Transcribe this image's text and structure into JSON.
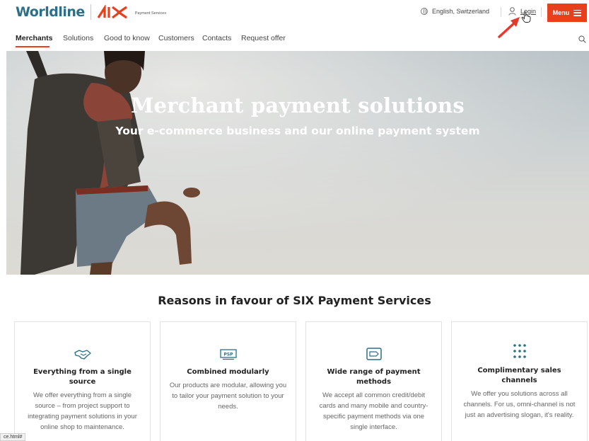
{
  "header": {
    "brand_name": "Worldline",
    "brand_partner": "SIX",
    "brand_tagline": "Payment Services",
    "language": "English, Switzerland",
    "login_label": "Login",
    "menu_label": "Menu",
    "accent_color": "#e8401c",
    "brand_color": "#2b6f8a"
  },
  "nav": {
    "items": [
      {
        "label": "Merchants",
        "active": true
      },
      {
        "label": "Solutions"
      },
      {
        "label": "Good to know"
      },
      {
        "label": "Customers"
      },
      {
        "label": "Contacts"
      },
      {
        "label": "Request offer"
      }
    ],
    "search_icon": "search-icon"
  },
  "hero": {
    "title": "Merchant payment solutions",
    "subtitle": "Your e-commerce business and our online payment system"
  },
  "reasons": {
    "title": "Reasons in favour of SIX Payment Services",
    "cards": [
      {
        "icon": "handshake-icon",
        "title": "Everything from a single source",
        "text": "We offer everything from a single source – from project support to integrating payment solutions in your online shop to maintenance."
      },
      {
        "icon": "psp-icon",
        "icon_text": "PSP",
        "title": "Combined modularly",
        "text": "Our products are modular, allowing you to tailor your payment solution to your needs."
      },
      {
        "icon": "payment-card-icon",
        "title": "Wide range of payment methods",
        "text": "We accept all common credit/debit cards and many mobile and country-specific payment methods via one single interface."
      },
      {
        "icon": "dots-grid-icon",
        "title": "Complimentary sales channels",
        "text": "We offer you solutions across all channels. For us, omni-channel is not just an advertising slogan, it's reality."
      }
    ]
  },
  "status_bar": {
    "url": "ce.html#"
  }
}
